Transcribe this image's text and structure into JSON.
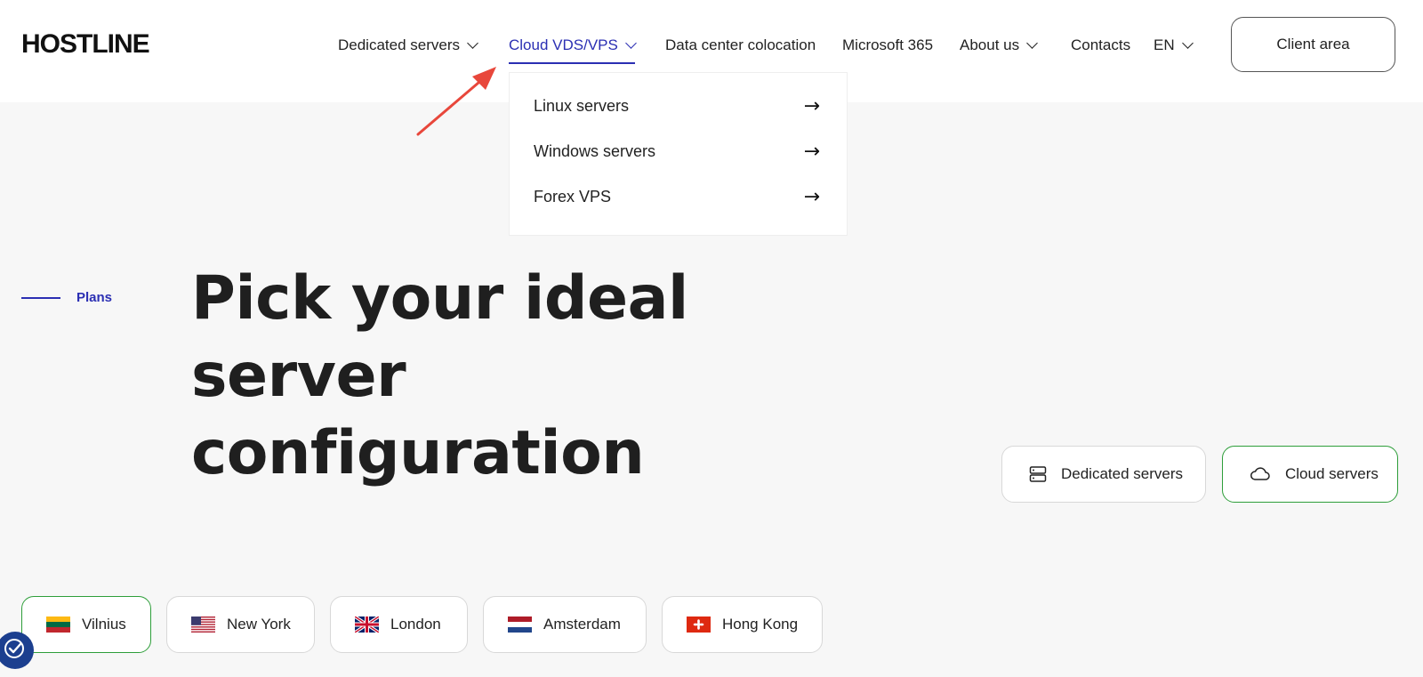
{
  "header": {
    "logo": "HOSTLINE",
    "nav": [
      {
        "label": "Dedicated servers",
        "has_dropdown": true
      },
      {
        "label": "Cloud VDS/VPS",
        "has_dropdown": true,
        "active": true
      },
      {
        "label": "Data center colocation",
        "has_dropdown": false
      },
      {
        "label": "Microsoft 365",
        "has_dropdown": false
      },
      {
        "label": "About us",
        "has_dropdown": true
      },
      {
        "label": "Contacts",
        "has_dropdown": false
      },
      {
        "label": "EN",
        "has_dropdown": true
      }
    ],
    "client_area": "Client area"
  },
  "dropdown": {
    "items": [
      {
        "label": "Linux servers",
        "icon": "arrow-right-icon"
      },
      {
        "label": "Windows servers",
        "icon": "arrow-right-icon"
      },
      {
        "label": "Forex VPS",
        "icon": "arrow-right-icon"
      }
    ]
  },
  "section": {
    "label": "Plans",
    "title_lines": [
      "Pick your ideal",
      "server",
      "configuration"
    ]
  },
  "server_types": [
    {
      "label": "Dedicated servers",
      "icon": "server-icon",
      "selected": false
    },
    {
      "label": "Cloud servers",
      "icon": "cloud-icon",
      "selected": true
    }
  ],
  "locations": [
    {
      "label": "Vilnius",
      "flag": "lithuania-flag-icon",
      "selected": true
    },
    {
      "label": "New York",
      "flag": "usa-flag-icon",
      "selected": false
    },
    {
      "label": "London",
      "flag": "uk-flag-icon",
      "selected": false
    },
    {
      "label": "Amsterdam",
      "flag": "netherlands-flag-icon",
      "selected": false
    },
    {
      "label": "Hong Kong",
      "flag": "hong-kong-flag-icon",
      "selected": false
    }
  ],
  "colors": {
    "accent": "#2b2fb3",
    "selected_border": "#2e9e3a",
    "annotation_arrow": "#e8473b",
    "accessibility_button": "#1c3f8f"
  }
}
